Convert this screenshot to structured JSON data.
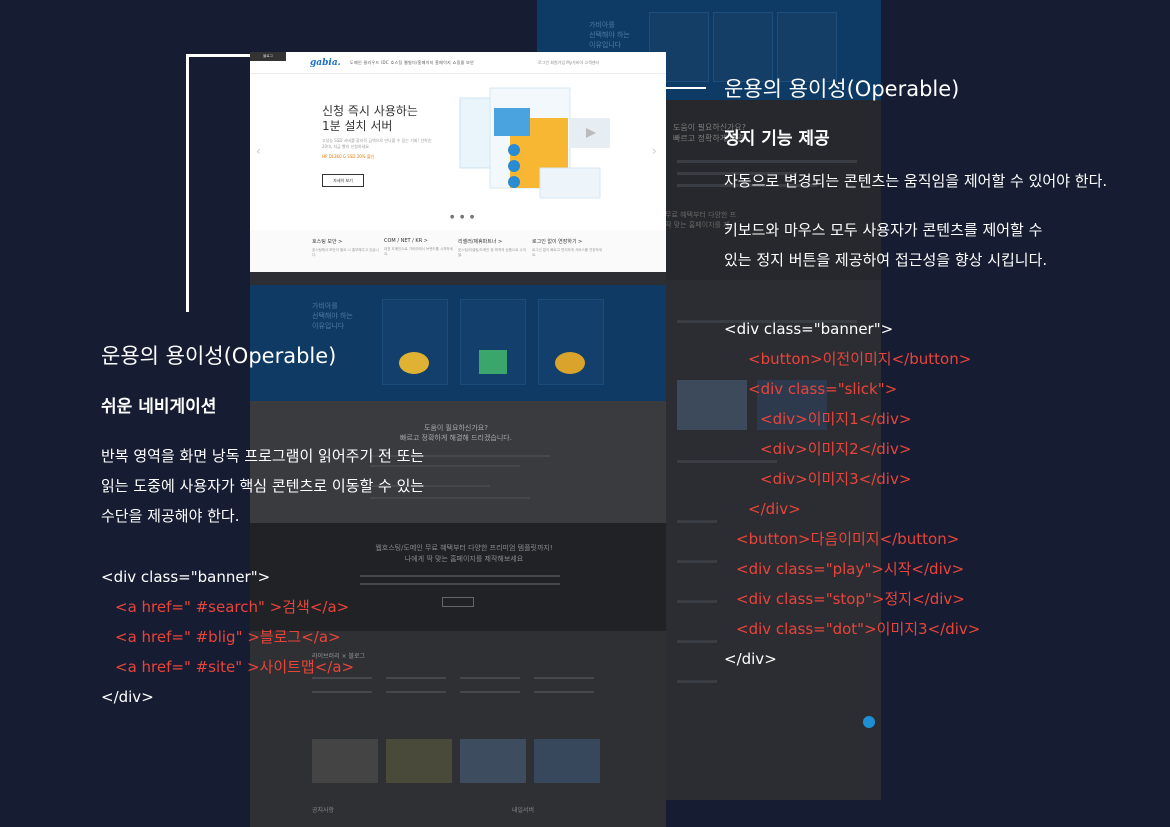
{
  "left": {
    "title": "운용의 용이성(Operable)",
    "subtitle": "쉬운 네비게이션",
    "desc": [
      "반복 영역을 화면 낭독 프로그램이 읽어주기 전 또는",
      "읽는 도중에 사용자가 핵심 콘텐츠로 이동할 수 있는",
      "수단을 제공해야 한다."
    ],
    "code_open": "<div class=\"banner\">",
    "code_lines": [
      "<a href=\" #search\" >검색</a>",
      "<a href=\" #blig\" >블로그</a>",
      "<a href=\" #site\" >사이트맵</a>"
    ],
    "code_close": "</div>"
  },
  "right": {
    "title": "운용의 용이성(Operable)",
    "subtitle": "정지 기능 제공",
    "desc1": "자동으로 변경되는 콘텐츠는 움직임을 제어할 수 있어야 한다.",
    "desc2": [
      "키보드와 마우스 모두 사용자가 콘텐츠를 제어할 수",
      "있는 정지 버튼을 제공하여 접근성을 향상 시킵니다."
    ],
    "code_open": "<div class=\"banner\">",
    "code_lines": [
      "<button>이전이미지</button>",
      "<div class=\"slick\">",
      "<div>이미지1</div>",
      "<div>이미지2</div>",
      "<div>이미지3</div>",
      "</div>",
      "<button>다음이미지</button>",
      "<div class=\"play\">시작</div>",
      "<div class=\"stop\">정지</div>",
      "<div class=\"dot\">이미지3</div>"
    ],
    "code_close": "</div>"
  },
  "site": {
    "logo": "gabia.",
    "menu": "도메인   클라우드   IDC   호스팅   웹빌더/홈페이지   홈페이지   쇼핑몰   보안",
    "util": "로그인   회원가입   My가비아   고객센터",
    "hero_title": [
      "신청 즉시 사용하는",
      "1분 설치 서버"
    ],
    "hero_sub": "고성능 SSD 서버를 합리적 금액으로 만나볼 수 있는 기회! 선착순 20대, 지금 빨리 신청하세요.",
    "hero_highlight": "HP DL360 G SSD 20% 할인",
    "hero_button": "자세히 보기",
    "tag": "블로그",
    "features": [
      {
        "title": "호스팅 보안 >",
        "desc": "호스팅에서 보안이 필요 시 홍보해주고 있습니다."
      },
      {
        "title": "COM / NET / KR >",
        "desc": "대표 도메인으로 가비아에서 브랜드를 시작하세요."
      },
      {
        "title": "리셀러/제휴파트너 >",
        "desc": "호스팅/리셀링/도메인 등 최적의 상품으로 수익을."
      },
      {
        "title": "로그인 없이 연장하기 >",
        "desc": "로그인 없이 빠르고 편리하게 서비스를 연장하세요."
      }
    ],
    "help": [
      "도움이 필요하신가요?",
      "빠르고 정확하게 해결해 드리겠습니다."
    ],
    "promo": [
      "웹호스팅/도메인 무료 혜택부터 다양한 프리미엄 템플릿까지!",
      "나에게 딱 맞는 홈페이지를 제작해보세요"
    ],
    "blog_header": "라이브러리  ×  블로그",
    "footer_left": "공지사항",
    "footer_right": "내일서버",
    "back_text": [
      "가비아를",
      "선택해야 하는",
      "이유입니다"
    ],
    "back_help": [
      "도움이 필요하신가요?",
      "빠르고 정확하게 해결"
    ],
    "back_promo": [
      "무료 혜택부터 다양한 프",
      "딱 맞는 홈페이지를 제"
    ]
  }
}
